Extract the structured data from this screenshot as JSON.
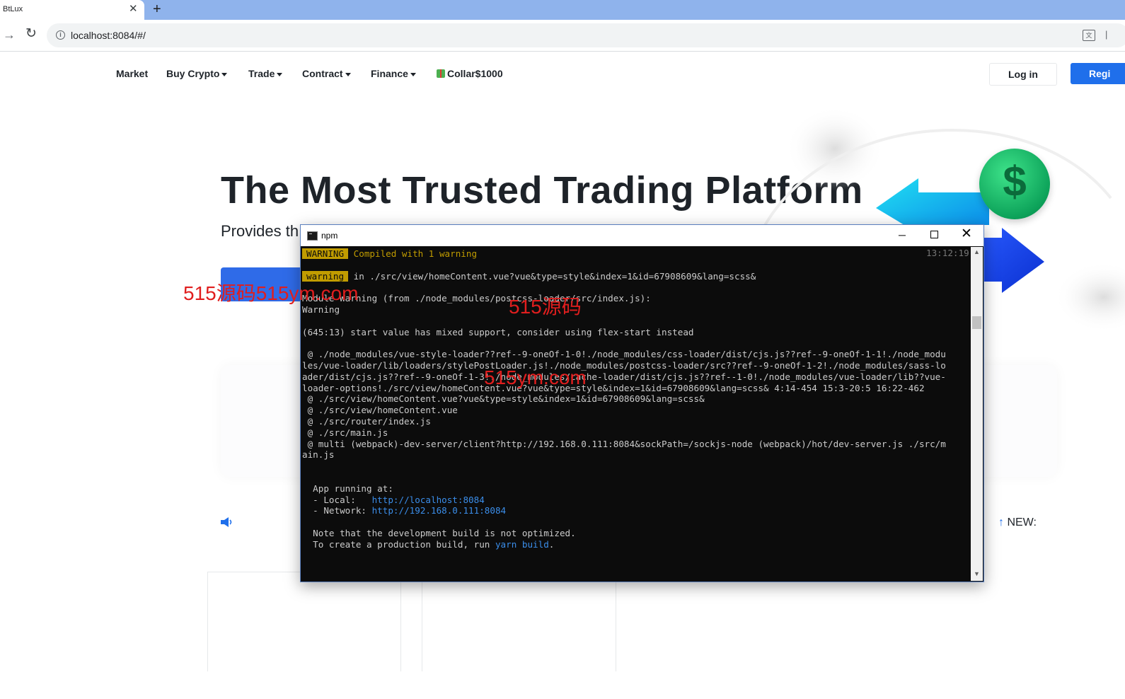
{
  "browser": {
    "tab_title": "BtLux",
    "tab_close": "✕",
    "new_tab": "+",
    "forward": "→",
    "reload": "↻",
    "url": "localhost:8084/#/"
  },
  "nav": {
    "items": [
      {
        "label": "Market"
      },
      {
        "label": "Buy Crypto"
      },
      {
        "label": "Trade"
      },
      {
        "label": "Contract"
      },
      {
        "label": "Finance"
      },
      {
        "label": "Collar$1000"
      }
    ],
    "login": "Log in",
    "register": "Regi"
  },
  "hero": {
    "title": "The Most Trusted Trading Platform",
    "subtitle": "Provides th"
  },
  "announce": {
    "new_label": "NEW:",
    "new_arrow": "↑"
  },
  "watermarks": [
    "515源码515ym.com",
    "515源码",
    "515ym.com"
  ],
  "console": {
    "title": "npm",
    "timestamp": "13:12:19",
    "lines": [
      {
        "badge": "WARNING",
        "text": " Compiled with 1 warning",
        "style": "yellow"
      },
      {
        "text": ""
      },
      {
        "badge": "warning",
        "text": " in ./src/view/homeContent.vue?vue&type=style&index=1&id=67908609&lang=scss&"
      },
      {
        "text": ""
      },
      {
        "text": "Module Warning (from ./node_modules/postcss-loader/src/index.js):"
      },
      {
        "text": "Warning"
      },
      {
        "text": ""
      },
      {
        "text": "(645:13) start value has mixed support, consider using flex-start instead"
      },
      {
        "text": ""
      },
      {
        "text": " @ ./node_modules/vue-style-loader??ref--9-oneOf-1-0!./node_modules/css-loader/dist/cjs.js??ref--9-oneOf-1-1!./node_modu"
      },
      {
        "text": "les/vue-loader/lib/loaders/stylePostLoader.js!./node_modules/postcss-loader/src??ref--9-oneOf-1-2!./node_modules/sass-lo"
      },
      {
        "text": "ader/dist/cjs.js??ref--9-oneOf-1-3!./node_modules/cache-loader/dist/cjs.js??ref--1-0!./node_modules/vue-loader/lib??vue-"
      },
      {
        "text": "loader-options!./src/view/homeContent.vue?vue&type=style&index=1&id=67908609&lang=scss& 4:14-454 15:3-20:5 16:22-462"
      },
      {
        "text": " @ ./src/view/homeContent.vue?vue&type=style&index=1&id=67908609&lang=scss&"
      },
      {
        "text": " @ ./src/view/homeContent.vue"
      },
      {
        "text": " @ ./src/router/index.js"
      },
      {
        "text": " @ ./src/main.js"
      },
      {
        "text": " @ multi (webpack)-dev-server/client?http://192.168.0.111:8084&sockPath=/sockjs-node (webpack)/hot/dev-server.js ./src/m"
      },
      {
        "text": "ain.js"
      },
      {
        "text": ""
      },
      {
        "text": ""
      },
      {
        "text": "  App running at:"
      },
      {
        "text": "  - Local:   ",
        "link": "http://localhost:8084"
      },
      {
        "text": "  - Network: ",
        "link": "http://192.168.0.111:8084"
      },
      {
        "text": ""
      },
      {
        "text": "  Note that the development build is not optimized."
      },
      {
        "text": "  To create a production build, run ",
        "link": "yarn build",
        "after": "."
      }
    ]
  },
  "colors": {
    "accent": "#1f6feb",
    "console_bg": "#0c0c0c",
    "warning_yellow": "#c19c00",
    "link_blue": "#3b8eea",
    "watermark_red": "#e01e1e"
  }
}
